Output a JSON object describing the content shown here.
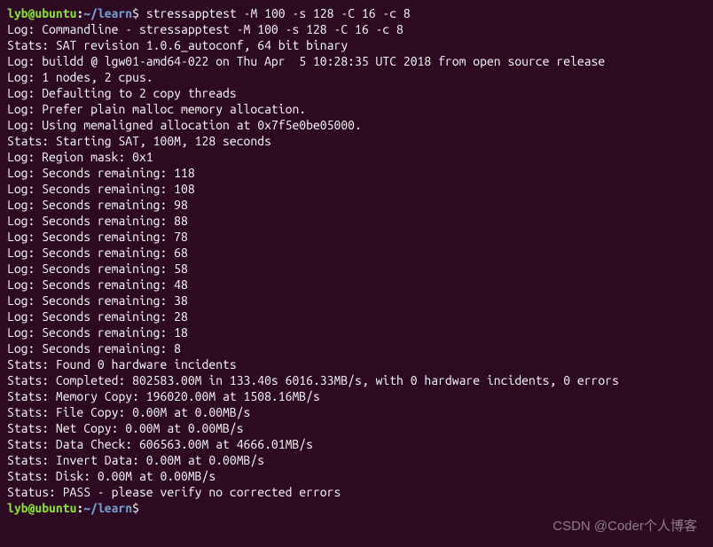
{
  "prompt": {
    "user": "lyb",
    "host": "ubuntu",
    "at": "@",
    "colon": ":",
    "path": "~/learn",
    "dollar": "$ "
  },
  "command": "stressapptest -M 100 -s 128 -C 16 -c 8",
  "output": [
    "Log: Commandline - stressapptest -M 100 -s 128 -C 16 -c 8",
    "Stats: SAT revision 1.0.6_autoconf, 64 bit binary",
    "Log: buildd @ lgw01-amd64-022 on Thu Apr  5 10:28:35 UTC 2018 from open source release",
    "Log: 1 nodes, 2 cpus.",
    "Log: Defaulting to 2 copy threads",
    "Log: Prefer plain malloc memory allocation.",
    "Log: Using memaligned allocation at 0x7f5e0be05000.",
    "Stats: Starting SAT, 100M, 128 seconds",
    "Log: Region mask: 0x1",
    "Log: Seconds remaining: 118",
    "Log: Seconds remaining: 108",
    "Log: Seconds remaining: 98",
    "Log: Seconds remaining: 88",
    "Log: Seconds remaining: 78",
    "Log: Seconds remaining: 68",
    "Log: Seconds remaining: 58",
    "Log: Seconds remaining: 48",
    "Log: Seconds remaining: 38",
    "Log: Seconds remaining: 28",
    "Log: Seconds remaining: 18",
    "Log: Seconds remaining: 8",
    "Stats: Found 0 hardware incidents",
    "Stats: Completed: 802583.00M in 133.40s 6016.33MB/s, with 0 hardware incidents, 0 errors",
    "Stats: Memory Copy: 196020.00M at 1508.16MB/s",
    "Stats: File Copy: 0.00M at 0.00MB/s",
    "Stats: Net Copy: 0.00M at 0.00MB/s",
    "Stats: Data Check: 606563.00M at 4666.01MB/s",
    "Stats: Invert Data: 0.00M at 0.00MB/s",
    "Stats: Disk: 0.00M at 0.00MB/s",
    "",
    "Status: PASS - please verify no corrected errors",
    ""
  ],
  "watermark": "CSDN @Coder个人博客"
}
